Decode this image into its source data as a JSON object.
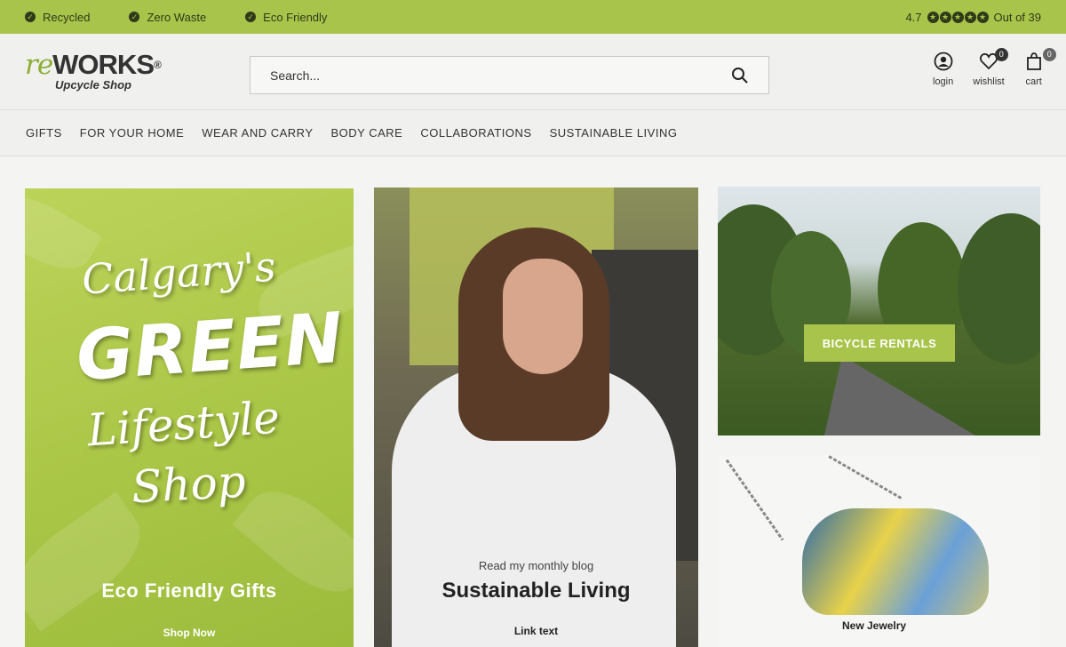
{
  "topbar": {
    "badges": [
      "Recycled",
      "Zero Waste",
      "Eco Friendly"
    ],
    "rating": "4.7",
    "rating_stars": 4.5,
    "rating_text": "Out of 39"
  },
  "header": {
    "logo_re": "re",
    "logo_works": "WORKS",
    "logo_reg": "®",
    "logo_sub": "Upcycle Shop",
    "search_placeholder": "Search...",
    "tools": {
      "login": "login",
      "wishlist": "wishlist",
      "wishlist_count": "0",
      "cart": "cart",
      "cart_count": "0"
    }
  },
  "nav": [
    "GIFTS",
    "FOR YOUR HOME",
    "WEAR AND CARRY",
    "BODY CARE",
    "COLLABORATIONS",
    "SUSTAINABLE LIVING"
  ],
  "hero": {
    "line1": "Calgary's",
    "line2": "GREEN",
    "line3": "Lifestyle",
    "line4": "Shop",
    "subtitle": "Eco Friendly Gifts",
    "cta": "Shop Now"
  },
  "blog": {
    "kicker": "Read my monthly blog",
    "title": "Sustainable Living",
    "link": "Link text"
  },
  "bike": {
    "button": "BICYCLE RENTALS"
  },
  "jewelry": {
    "label": "New Jewelry"
  },
  "colors": {
    "accent": "#a9c44a",
    "dark": "#2f3a1a"
  }
}
